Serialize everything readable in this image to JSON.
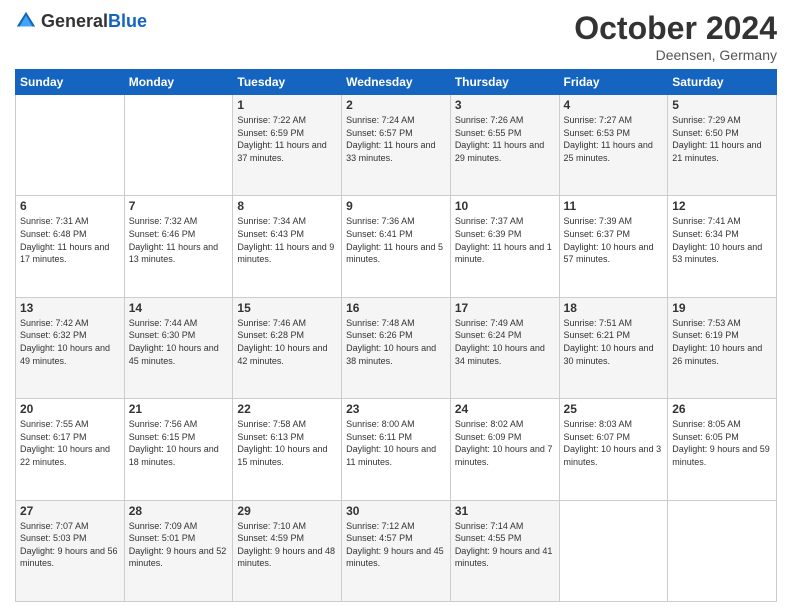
{
  "header": {
    "logo_general": "General",
    "logo_blue": "Blue",
    "month_title": "October 2024",
    "location": "Deensen, Germany"
  },
  "days_of_week": [
    "Sunday",
    "Monday",
    "Tuesday",
    "Wednesday",
    "Thursday",
    "Friday",
    "Saturday"
  ],
  "weeks": [
    [
      {
        "day": "",
        "sunrise": "",
        "sunset": "",
        "daylight": ""
      },
      {
        "day": "",
        "sunrise": "",
        "sunset": "",
        "daylight": ""
      },
      {
        "day": "1",
        "sunrise": "Sunrise: 7:22 AM",
        "sunset": "Sunset: 6:59 PM",
        "daylight": "Daylight: 11 hours and 37 minutes."
      },
      {
        "day": "2",
        "sunrise": "Sunrise: 7:24 AM",
        "sunset": "Sunset: 6:57 PM",
        "daylight": "Daylight: 11 hours and 33 minutes."
      },
      {
        "day": "3",
        "sunrise": "Sunrise: 7:26 AM",
        "sunset": "Sunset: 6:55 PM",
        "daylight": "Daylight: 11 hours and 29 minutes."
      },
      {
        "day": "4",
        "sunrise": "Sunrise: 7:27 AM",
        "sunset": "Sunset: 6:53 PM",
        "daylight": "Daylight: 11 hours and 25 minutes."
      },
      {
        "day": "5",
        "sunrise": "Sunrise: 7:29 AM",
        "sunset": "Sunset: 6:50 PM",
        "daylight": "Daylight: 11 hours and 21 minutes."
      }
    ],
    [
      {
        "day": "6",
        "sunrise": "Sunrise: 7:31 AM",
        "sunset": "Sunset: 6:48 PM",
        "daylight": "Daylight: 11 hours and 17 minutes."
      },
      {
        "day": "7",
        "sunrise": "Sunrise: 7:32 AM",
        "sunset": "Sunset: 6:46 PM",
        "daylight": "Daylight: 11 hours and 13 minutes."
      },
      {
        "day": "8",
        "sunrise": "Sunrise: 7:34 AM",
        "sunset": "Sunset: 6:43 PM",
        "daylight": "Daylight: 11 hours and 9 minutes."
      },
      {
        "day": "9",
        "sunrise": "Sunrise: 7:36 AM",
        "sunset": "Sunset: 6:41 PM",
        "daylight": "Daylight: 11 hours and 5 minutes."
      },
      {
        "day": "10",
        "sunrise": "Sunrise: 7:37 AM",
        "sunset": "Sunset: 6:39 PM",
        "daylight": "Daylight: 11 hours and 1 minute."
      },
      {
        "day": "11",
        "sunrise": "Sunrise: 7:39 AM",
        "sunset": "Sunset: 6:37 PM",
        "daylight": "Daylight: 10 hours and 57 minutes."
      },
      {
        "day": "12",
        "sunrise": "Sunrise: 7:41 AM",
        "sunset": "Sunset: 6:34 PM",
        "daylight": "Daylight: 10 hours and 53 minutes."
      }
    ],
    [
      {
        "day": "13",
        "sunrise": "Sunrise: 7:42 AM",
        "sunset": "Sunset: 6:32 PM",
        "daylight": "Daylight: 10 hours and 49 minutes."
      },
      {
        "day": "14",
        "sunrise": "Sunrise: 7:44 AM",
        "sunset": "Sunset: 6:30 PM",
        "daylight": "Daylight: 10 hours and 45 minutes."
      },
      {
        "day": "15",
        "sunrise": "Sunrise: 7:46 AM",
        "sunset": "Sunset: 6:28 PM",
        "daylight": "Daylight: 10 hours and 42 minutes."
      },
      {
        "day": "16",
        "sunrise": "Sunrise: 7:48 AM",
        "sunset": "Sunset: 6:26 PM",
        "daylight": "Daylight: 10 hours and 38 minutes."
      },
      {
        "day": "17",
        "sunrise": "Sunrise: 7:49 AM",
        "sunset": "Sunset: 6:24 PM",
        "daylight": "Daylight: 10 hours and 34 minutes."
      },
      {
        "day": "18",
        "sunrise": "Sunrise: 7:51 AM",
        "sunset": "Sunset: 6:21 PM",
        "daylight": "Daylight: 10 hours and 30 minutes."
      },
      {
        "day": "19",
        "sunrise": "Sunrise: 7:53 AM",
        "sunset": "Sunset: 6:19 PM",
        "daylight": "Daylight: 10 hours and 26 minutes."
      }
    ],
    [
      {
        "day": "20",
        "sunrise": "Sunrise: 7:55 AM",
        "sunset": "Sunset: 6:17 PM",
        "daylight": "Daylight: 10 hours and 22 minutes."
      },
      {
        "day": "21",
        "sunrise": "Sunrise: 7:56 AM",
        "sunset": "Sunset: 6:15 PM",
        "daylight": "Daylight: 10 hours and 18 minutes."
      },
      {
        "day": "22",
        "sunrise": "Sunrise: 7:58 AM",
        "sunset": "Sunset: 6:13 PM",
        "daylight": "Daylight: 10 hours and 15 minutes."
      },
      {
        "day": "23",
        "sunrise": "Sunrise: 8:00 AM",
        "sunset": "Sunset: 6:11 PM",
        "daylight": "Daylight: 10 hours and 11 minutes."
      },
      {
        "day": "24",
        "sunrise": "Sunrise: 8:02 AM",
        "sunset": "Sunset: 6:09 PM",
        "daylight": "Daylight: 10 hours and 7 minutes."
      },
      {
        "day": "25",
        "sunrise": "Sunrise: 8:03 AM",
        "sunset": "Sunset: 6:07 PM",
        "daylight": "Daylight: 10 hours and 3 minutes."
      },
      {
        "day": "26",
        "sunrise": "Sunrise: 8:05 AM",
        "sunset": "Sunset: 6:05 PM",
        "daylight": "Daylight: 9 hours and 59 minutes."
      }
    ],
    [
      {
        "day": "27",
        "sunrise": "Sunrise: 7:07 AM",
        "sunset": "Sunset: 5:03 PM",
        "daylight": "Daylight: 9 hours and 56 minutes."
      },
      {
        "day": "28",
        "sunrise": "Sunrise: 7:09 AM",
        "sunset": "Sunset: 5:01 PM",
        "daylight": "Daylight: 9 hours and 52 minutes."
      },
      {
        "day": "29",
        "sunrise": "Sunrise: 7:10 AM",
        "sunset": "Sunset: 4:59 PM",
        "daylight": "Daylight: 9 hours and 48 minutes."
      },
      {
        "day": "30",
        "sunrise": "Sunrise: 7:12 AM",
        "sunset": "Sunset: 4:57 PM",
        "daylight": "Daylight: 9 hours and 45 minutes."
      },
      {
        "day": "31",
        "sunrise": "Sunrise: 7:14 AM",
        "sunset": "Sunset: 4:55 PM",
        "daylight": "Daylight: 9 hours and 41 minutes."
      },
      {
        "day": "",
        "sunrise": "",
        "sunset": "",
        "daylight": ""
      },
      {
        "day": "",
        "sunrise": "",
        "sunset": "",
        "daylight": ""
      }
    ]
  ]
}
